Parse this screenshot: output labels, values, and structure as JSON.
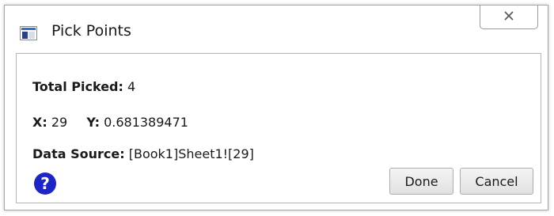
{
  "window": {
    "title": "Pick Points",
    "icons": {
      "app": "chart-window-icon",
      "close": "close-icon",
      "help": "help-icon"
    }
  },
  "info": {
    "total_label": "Total Picked:",
    "total_value": "4",
    "x_label": "X:",
    "x_value": "29",
    "y_label": "Y:",
    "y_value": "0.681389471",
    "source_label": "Data Source:",
    "source_value": "[Book1]Sheet1![29]"
  },
  "buttons": {
    "help": "?",
    "done": "Done",
    "cancel": "Cancel"
  },
  "colors": {
    "help_badge": "#1e25c8",
    "close_x": "#555555"
  }
}
